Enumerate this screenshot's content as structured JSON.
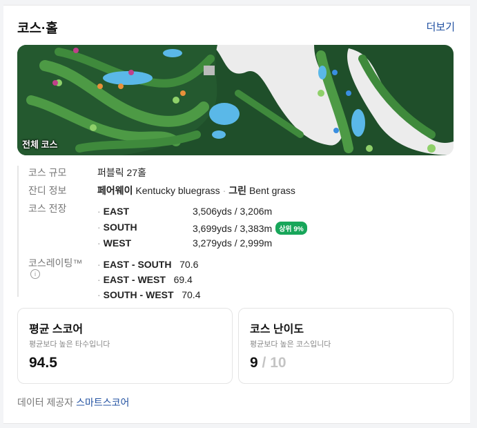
{
  "header": {
    "title": "코스·홀",
    "more_label": "더보기"
  },
  "map": {
    "label": "전체 코스"
  },
  "info": {
    "scale_label": "코스 규모",
    "scale_value": "퍼블릭 27홀",
    "grass_label": "잔디 정보",
    "grass_fairway_type": "페어웨이",
    "grass_fairway_value": "Kentucky bluegrass",
    "grass_green_type": "그린",
    "grass_green_value": "Bent grass",
    "length_label": "코스 전장",
    "lengths": [
      {
        "course": "EAST",
        "length": "3,506yds / 3,206m"
      },
      {
        "course": "SOUTH",
        "length": "3,699yds / 3,383m",
        "badge": "상위 9%"
      },
      {
        "course": "WEST",
        "length": "3,279yds / 2,999m"
      }
    ],
    "rating_label": "코스레이팅™",
    "ratings": [
      {
        "combo": "EAST - SOUTH",
        "value": "70.6"
      },
      {
        "combo": "EAST - WEST",
        "value": "69.4"
      },
      {
        "combo": "SOUTH - WEST",
        "value": "70.4"
      }
    ]
  },
  "score_box": {
    "title": "평균 스코어",
    "subtitle": "평균보다 높은 타수입니다",
    "value": "94.5"
  },
  "difficulty_box": {
    "title": "코스 난이도",
    "subtitle": "평균보다 높은 코스입니다",
    "value": "9",
    "total": "/ 10"
  },
  "footer": {
    "prefix": "데이터 제공자",
    "provider": "스마트스코어"
  },
  "colors": {
    "accent_link": "#1f4fa0",
    "badge_green": "#18a65a",
    "fairway": "#3f8a3c",
    "rough": "#1f4f2a",
    "water": "#5ab8e8"
  }
}
